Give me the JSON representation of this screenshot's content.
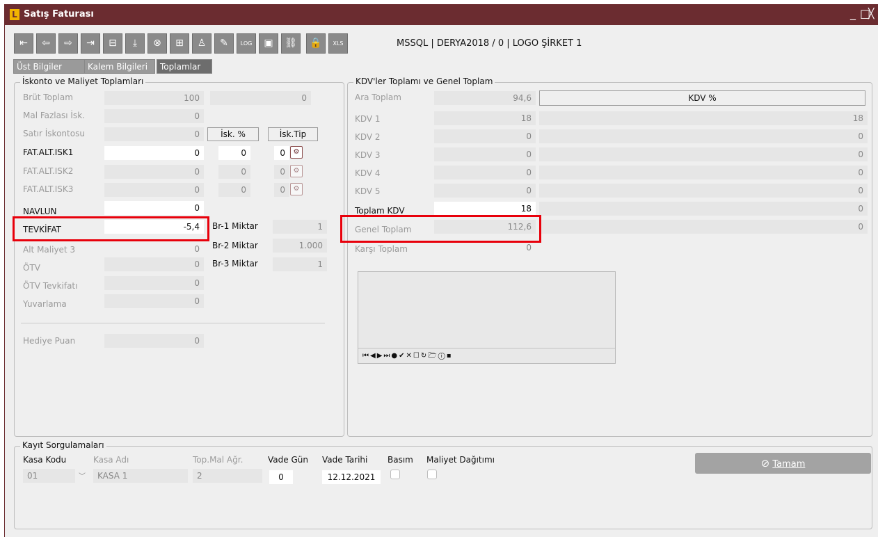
{
  "window": {
    "title": "Satış Faturası",
    "logo_letter": "L",
    "btn_min": "_",
    "btn_max": "□",
    "btn_close": "╳"
  },
  "toolbar": {
    "icons": [
      "first-record-icon",
      "prev-record-icon",
      "next-record-icon",
      "last-record-icon",
      "minus-icon",
      "download-icon",
      "cancel-icon",
      "add-icon",
      "user-icon",
      "edit-icon",
      "log-icon",
      "document-icon",
      "link-icon",
      "lock-icon",
      "xls-icon"
    ],
    "glyphs": [
      "⇤",
      "⇦",
      "⇨",
      "⇥",
      "⊟",
      "⤓",
      "⊗",
      "⊞",
      "♙",
      "✎",
      "LOG",
      "▣",
      "⛓",
      "🔒",
      "XLS"
    ],
    "server_info": "MSSQL | DERYA2018 / 0 | LOGO ŞİRKET 1"
  },
  "tabs": [
    {
      "label": "Üst Bilgiler"
    },
    {
      "label": "Kalem Bilgileri"
    },
    {
      "label": "Toplamlar"
    }
  ],
  "left_group": {
    "title": "İskonto ve Maliyet Toplamları",
    "brut_toplam": {
      "label": "Brüt Toplam",
      "value": "100",
      "value2": "0"
    },
    "mal_fazlasi": {
      "label": "Mal Fazlası İsk.",
      "value": "0"
    },
    "satir_iskontosu": {
      "label": "Satır İskontosu",
      "value": "0"
    },
    "isk_pct_header": "İsk. %",
    "isk_tip_header": "İsk.Tip",
    "fat_alt_isk1": {
      "label": "FAT.ALT.ISK1",
      "value": "0",
      "pct": "0",
      "tip": "0"
    },
    "fat_alt_isk2": {
      "label": "FAT.ALT.ISK2",
      "value": "0",
      "pct": "0",
      "tip": "0"
    },
    "fat_alt_isk3": {
      "label": "FAT.ALT.ISK3",
      "value": "0",
      "pct": "0",
      "tip": "0"
    },
    "navlun": {
      "label": "NAVLUN",
      "value": "0"
    },
    "tevkifat": {
      "label": "TEVKİFAT",
      "value": "-5,4"
    },
    "alt_maliyet3": {
      "label": "Alt Maliyet 3",
      "value": "0"
    },
    "otv": {
      "label": "ÖTV",
      "value": "0"
    },
    "otv_tevkifati": {
      "label": "ÖTV Tevkifatı",
      "value": "0"
    },
    "yuvarlama": {
      "label": "Yuvarlama",
      "value": "0"
    },
    "hediye_puan": {
      "label": "Hediye Puan",
      "value": "0"
    },
    "br1": {
      "label": "Br-1 Miktar",
      "value": "1"
    },
    "br2": {
      "label": "Br-2 Miktar",
      "value": "1.000"
    },
    "br3": {
      "label": "Br-3 Miktar",
      "value": "1"
    }
  },
  "right_group": {
    "title": "KDV'ler Toplamı ve Genel Toplam",
    "ara_toplam": {
      "label": "Ara Toplam",
      "value": "94,6"
    },
    "kdv_header": "KDV %",
    "kdv_rows": [
      {
        "label": "KDV 1",
        "value": "18",
        "pct": "18"
      },
      {
        "label": "KDV 2",
        "value": "0",
        "pct": "0"
      },
      {
        "label": "KDV 3",
        "value": "0",
        "pct": "0"
      },
      {
        "label": "KDV 4",
        "value": "0",
        "pct": "0"
      },
      {
        "label": "KDV 5",
        "value": "0",
        "pct": "0"
      }
    ],
    "toplam_kdv": {
      "label": "Toplam KDV",
      "value": "18",
      "pct": "0"
    },
    "genel_toplam": {
      "label": "Genel Toplam",
      "value": "112,6",
      "pct": "0"
    },
    "karsi_toplam": {
      "label": "Karşı Toplam",
      "value": "0"
    },
    "memo_nav": "⏮◀▶⏭●✔✕☐↻🗁ⓘ▪"
  },
  "bottom_group": {
    "title": "Kayıt Sorgulamaları",
    "kasa_kodu": {
      "label": "Kasa Kodu",
      "value": "01"
    },
    "kasa_adi": {
      "label": "Kasa Adı",
      "value": "KASA 1"
    },
    "top_mal_agr": {
      "label": "Top.Mal Ağr.",
      "value": "2"
    },
    "vade_gun": {
      "label": "Vade Gün",
      "value": "0"
    },
    "vade_tarihi": {
      "label": "Vade Tarihi",
      "value": "12.12.2021"
    },
    "basim": {
      "label": "Basım"
    },
    "maliyet_dagitimi": {
      "label": "Maliyet Dağıtımı"
    },
    "ok_label": "Tamam"
  }
}
